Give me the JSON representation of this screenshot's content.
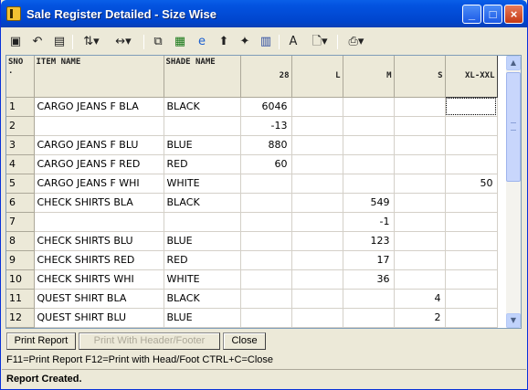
{
  "window": {
    "title": "Sale Register Detailed - Size Wise"
  },
  "toolbar": {
    "tools": [
      "save-icon",
      "undo-icon",
      "print-setup-icon",
      "sort-icon",
      "column-width-icon",
      "copy-icon",
      "excel-icon",
      "internet-explorer-icon",
      "find-icon",
      "up-arrow-icon",
      "bar-chart-icon",
      "font-icon",
      "preview-icon",
      "printer-icon"
    ]
  },
  "grid": {
    "headers": {
      "sno": "SNO .",
      "item": "ITEM NAME",
      "shade": "SHADE NAME",
      "s28": "28",
      "sL": "L",
      "sM": "M",
      "sS": "S",
      "sXL": "XL-XXL"
    },
    "rows": [
      {
        "sno": "1",
        "item": "CARGO JEANS F BLA",
        "shade": "BLACK",
        "s28": "6046",
        "sL": "",
        "sM": "",
        "sS": "",
        "sXL": ""
      },
      {
        "sno": "2",
        "item": "",
        "shade": "",
        "s28": "-13",
        "sL": "",
        "sM": "",
        "sS": "",
        "sXL": ""
      },
      {
        "sno": "3",
        "item": "CARGO JEANS F BLU",
        "shade": "BLUE",
        "s28": "880",
        "sL": "",
        "sM": "",
        "sS": "",
        "sXL": ""
      },
      {
        "sno": "4",
        "item": "CARGO JEANS F RED",
        "shade": "RED",
        "s28": "60",
        "sL": "",
        "sM": "",
        "sS": "",
        "sXL": ""
      },
      {
        "sno": "5",
        "item": "CARGO JEANS F WHI",
        "shade": "WHITE",
        "s28": "",
        "sL": "",
        "sM": "",
        "sS": "",
        "sXL": "50"
      },
      {
        "sno": "6",
        "item": "CHECK SHIRTS BLA",
        "shade": "BLACK",
        "s28": "",
        "sL": "",
        "sM": "549",
        "sS": "",
        "sXL": ""
      },
      {
        "sno": "7",
        "item": "",
        "shade": "",
        "s28": "",
        "sL": "",
        "sM": "-1",
        "sS": "",
        "sXL": ""
      },
      {
        "sno": "8",
        "item": "CHECK SHIRTS BLU",
        "shade": "BLUE",
        "s28": "",
        "sL": "",
        "sM": "123",
        "sS": "",
        "sXL": ""
      },
      {
        "sno": "9",
        "item": "CHECK SHIRTS RED",
        "shade": "RED",
        "s28": "",
        "sL": "",
        "sM": "17",
        "sS": "",
        "sXL": ""
      },
      {
        "sno": "10",
        "item": "CHECK SHIRTS WHI",
        "shade": "WHITE",
        "s28": "",
        "sL": "",
        "sM": "36",
        "sS": "",
        "sXL": ""
      },
      {
        "sno": "11",
        "item": "QUEST SHIRT BLA",
        "shade": "BLACK",
        "s28": "",
        "sL": "",
        "sM": "",
        "sS": "4",
        "sXL": ""
      },
      {
        "sno": "12",
        "item": "QUEST SHIRT BLU",
        "shade": "BLUE",
        "s28": "",
        "sL": "",
        "sM": "",
        "sS": "2",
        "sXL": ""
      }
    ]
  },
  "buttons": {
    "print_report": "Print Report",
    "print_header_footer": "Print With Header/Footer",
    "close": "Close"
  },
  "hint": "F11=Print Report  F12=Print with Head/Foot  CTRL+C=Close",
  "status": "Report Created."
}
